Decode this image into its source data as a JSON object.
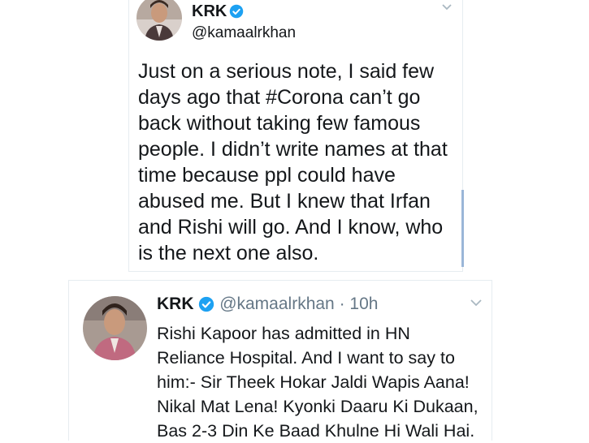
{
  "tweets": [
    {
      "author_name": "KRK",
      "handle": "@kamaalrkhan",
      "text": "Just on a serious note, I said few days ago that #Corona can’t go back without taking few famous people. I didn’t write names at that time because ppl could have abused me. But I knew that Irfan and Rishi will go. And I know, who is the next one also."
    },
    {
      "author_name": "KRK",
      "handle": "@kamaalrkhan",
      "separator": "·",
      "time": "10h",
      "text": "Rishi Kapoor has admitted in HN Reliance Hospital. And I want to say to him:- Sir Theek Hokar Jaldi Wapis Aana! Nikal Mat Lena! Kyonki Daaru Ki Dukaan, Bas 2-3 Din Ke Baad Khulne Hi Wali Hai."
    }
  ],
  "icons": {
    "verified": "verified-badge-icon",
    "menu": "chevron-down-icon",
    "avatar": "avatar"
  },
  "colors": {
    "verified_blue": "#1da1f2",
    "text": "#14171a",
    "muted": "#657786",
    "border": "#e6ecf0"
  }
}
